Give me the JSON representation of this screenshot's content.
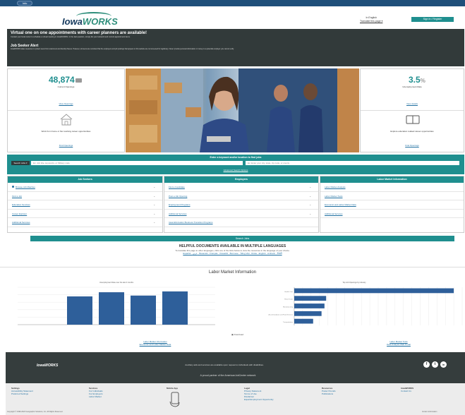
{
  "topbar": {
    "lang_pill": "Info"
  },
  "header": {
    "logo_a": "Iowa",
    "logo_b": "WORKS",
    "lang_line1": "In English",
    "lang_line2": "Translate this page ▾",
    "signin": "Sign In / Register"
  },
  "alert": {
    "title": "Virtual one on one appointments with career planners are available!",
    "text": "Contact your local center to schedule a virtual meeting in IowaWORKS. In the last question, simply list your telework and current appointment items.",
    "title2": "Job Seeker Alert",
    "text2": "IowaWORKS takes measures to protect users from scammers and identity thieves. However, all users are reminded that the employers and job postings that appear on this website are not screened for legitimacy. Never provide personal information or money to a potential employer you cannot verify."
  },
  "stats": {
    "jobs_num": "48,874",
    "jobs_label": "Current Openings",
    "jobs_link": "View Openings",
    "promo_text": "Work from home or flex working career opportunities",
    "promo_link": "Find Openings",
    "unemp_num": "3.5",
    "unemp_label": "Unemployment Rate",
    "unemp_link": "View details",
    "edu_text": "Explore education related career opportunities",
    "edu_link": "Find Openings"
  },
  "search": {
    "title": "Enter a keyword and/or location to find jobs",
    "type_button": "Search Jobs ▾",
    "keyword_placeholder": "Ex: Job title, keywords, or Military code",
    "location_placeholder": "Ex: Enter your city, state, zip code, or county",
    "advanced_link": "Advanced Search Options"
  },
  "columns": [
    {
      "title": "Job Seekers",
      "items": [
        "Browse Job Matches",
        "Find a Job",
        "Education Services",
        "Career Explorer",
        "Additional Services"
      ]
    },
    {
      "title": "Employers",
      "items": [
        "Find a Candidate",
        "Post a Job Opening",
        "Employment Programs",
        "Additional Services",
        "Iowa Elimination Business Transition Programs"
      ]
    },
    {
      "title": "Labor Market Information",
      "items": [
        "Labor Market Analysis",
        "Labor Market Tools",
        "Economic and Labor Market Data",
        "Additional Services"
      ]
    }
  ],
  "search_button": "Search Jobs",
  "helpful": {
    "title": "HELPFUL DOCUMENTS AVAILABLE IN MULTIPLE LANGUAGES",
    "subtitle": "To translate this page to other languages, click one of the links below to view the resources in the language of your choice.",
    "langs": "Español · عربي · Bosanski · Français · Kiswahili · Burmese · Tiếng Việt · Dinka · English · Amharic · नेपाली"
  },
  "lmi": {
    "title": "Labor Market Information",
    "dl_label": "Download",
    "link1a": "Labor Market Information",
    "link1b": "Economic and Labor Market Data",
    "link2a": "Labor Market Tools",
    "link2b": "Data Analysis Web Portal"
  },
  "chart_data": [
    {
      "type": "bar",
      "title": "Unemployment Rate over the last 4 months",
      "categories": [
        "",
        "",
        "",
        ""
      ],
      "values": [
        3.4,
        3.9,
        3.5,
        4.0
      ],
      "ylim": [
        0,
        4.5
      ],
      "xlabel": "",
      "ylabel": "",
      "grid": true
    },
    {
      "type": "bar",
      "orientation": "horizontal",
      "title": "Top Job Openings by Industry",
      "categories": [
        "Health Care",
        "Retail Trade",
        "Manufacturing",
        "Accommodation and Food Services",
        "Transportation"
      ],
      "values": [
        3800,
        760,
        720,
        650,
        450
      ],
      "xlim": [
        0,
        4000
      ],
      "grid": true
    }
  ],
  "footer": {
    "logo": "IowaWORKS",
    "text1": "Auxiliary aids and services are available upon request to individuals with disabilities.",
    "text2": "A proud partner of the AmericanJobCenter network",
    "social": [
      "f",
      "t",
      "in"
    ],
    "cols": [
      {
        "head": "Settings",
        "items": [
          "Accessibility Statement",
          "Preferred Settings"
        ]
      },
      {
        "head": "Services",
        "items": [
          "For Individuals",
          "For Employers",
          "Labor Market"
        ]
      },
      {
        "head": "Mobile App",
        "items": []
      },
      {
        "head": "Legal",
        "items": [
          "Privacy Statement",
          "Terms of Use",
          "Disclaimer",
          "Equal Employment Opportunity"
        ]
      },
      {
        "head": "Resources",
        "items": [
          "Poster Pounds",
          "Publications"
        ]
      },
      {
        "head": "IowaWORKS",
        "items": [
          "Contact Us"
        ]
      }
    ],
    "copyright": "Copyright © 1999-2023 Geographic Solutions, Inc. All Rights Reserved.",
    "version": "Version information"
  }
}
